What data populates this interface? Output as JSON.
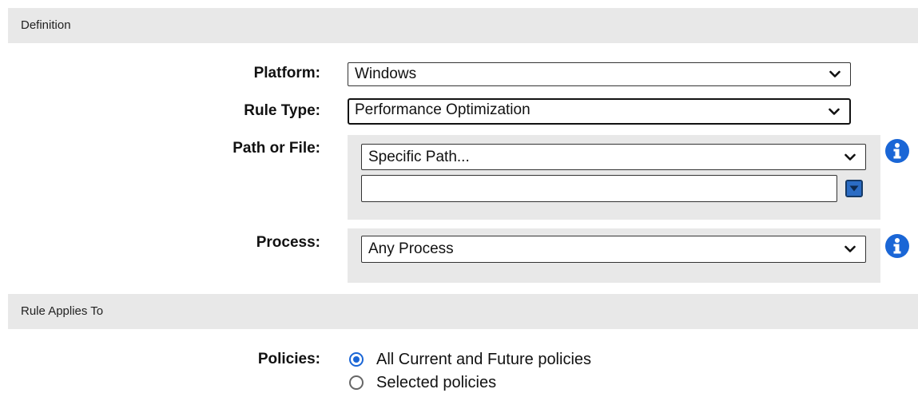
{
  "sections": {
    "definition": "Definition",
    "rule_applies_to": "Rule Applies To"
  },
  "fields": {
    "platform": {
      "label": "Platform:",
      "value": "Windows"
    },
    "rule_type": {
      "label": "Rule Type:",
      "value": "Performance Optimization"
    },
    "path_or_file": {
      "label": "Path or File:",
      "value": "Specific Path...",
      "path_input_value": ""
    },
    "process": {
      "label": "Process:",
      "value": "Any Process"
    },
    "policies": {
      "label": "Policies:",
      "options": [
        {
          "label": "All Current and Future policies",
          "checked": true
        },
        {
          "label": "Selected policies",
          "checked": false
        }
      ]
    }
  },
  "icons": {
    "info": "info-icon",
    "browse": "dropdown-browse-icon",
    "chevron": "chevron-down-icon"
  },
  "colors": {
    "section_bg": "#e8e8e8",
    "info_blue": "#1a66d6",
    "radio_selected": "#1a66d6"
  }
}
